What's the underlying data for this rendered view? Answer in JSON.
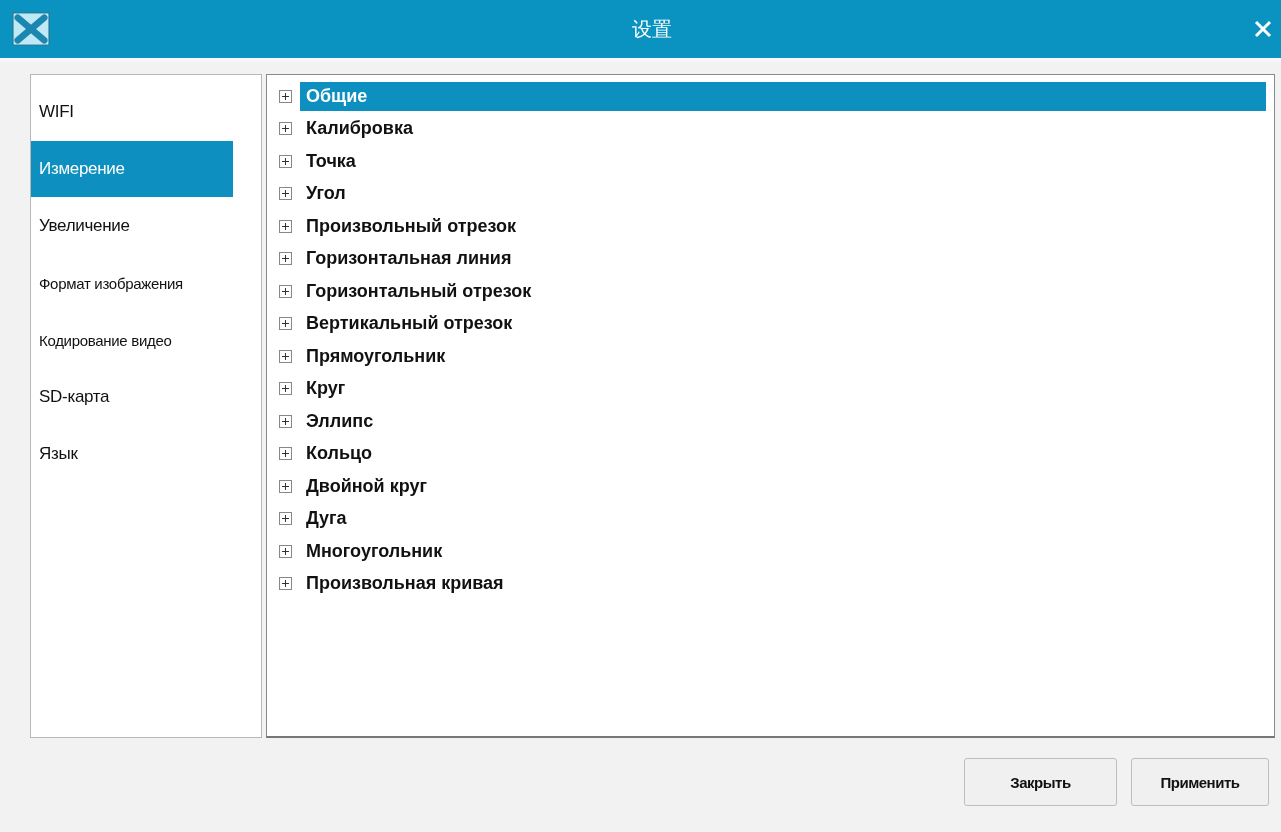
{
  "window": {
    "title": "设置"
  },
  "sidebar": {
    "items": [
      {
        "label": "WIFI",
        "selected": false
      },
      {
        "label": "Измерение",
        "selected": true
      },
      {
        "label": "Увеличение",
        "selected": false
      },
      {
        "label": "Формат изображения",
        "selected": false
      },
      {
        "label": "Кодирование видео",
        "selected": false
      },
      {
        "label": "SD-карта",
        "selected": false
      },
      {
        "label": "Язык",
        "selected": false
      }
    ]
  },
  "tree": {
    "items": [
      {
        "label": "Общие",
        "selected": true,
        "expanded": false
      },
      {
        "label": "Калибровка",
        "selected": false,
        "expanded": false
      },
      {
        "label": "Точка",
        "selected": false,
        "expanded": false
      },
      {
        "label": "Угол",
        "selected": false,
        "expanded": false
      },
      {
        "label": "Произвольный отрезок",
        "selected": false,
        "expanded": false
      },
      {
        "label": "Горизонтальная линия",
        "selected": false,
        "expanded": false
      },
      {
        "label": "Горизонтальный отрезок",
        "selected": false,
        "expanded": false
      },
      {
        "label": "Вертикальный отрезок",
        "selected": false,
        "expanded": false
      },
      {
        "label": "Прямоугольник",
        "selected": false,
        "expanded": false
      },
      {
        "label": "Круг",
        "selected": false,
        "expanded": false
      },
      {
        "label": "Эллипс",
        "selected": false,
        "expanded": false
      },
      {
        "label": "Кольцо",
        "selected": false,
        "expanded": false
      },
      {
        "label": "Двойной круг",
        "selected": false,
        "expanded": false
      },
      {
        "label": "Дуга",
        "selected": false,
        "expanded": false
      },
      {
        "label": "Многоугольник",
        "selected": false,
        "expanded": false
      },
      {
        "label": "Произвольная кривая",
        "selected": false,
        "expanded": false
      }
    ]
  },
  "buttons": [
    {
      "label": "Закрыть"
    },
    {
      "label": "Применить"
    }
  ]
}
